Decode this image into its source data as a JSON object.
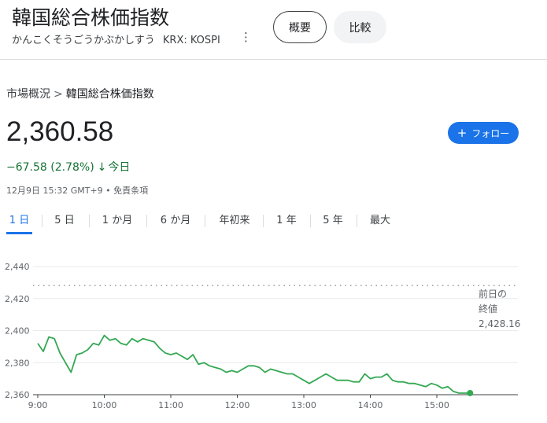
{
  "header": {
    "title": "韓国総合株価指数",
    "reading": "かんこくそうごうかぶかしすう",
    "ticker": "KRX: KOSPI",
    "more_icon": "⋮",
    "overview_label": "概要",
    "compare_label": "比較"
  },
  "breadcrumb": {
    "parent": "市場概況",
    "separator": ">",
    "current": "韓国総合株価指数"
  },
  "quote": {
    "price": "2,360.58",
    "change": "−67.58 (2.78%)",
    "arrow": "🡓",
    "period": "今日",
    "meta": "12月9日 15:32 GMT+9 • 免責条項"
  },
  "follow": {
    "icon": "+",
    "label": "フォロー"
  },
  "tabs": [
    "1 日",
    "5 日",
    "1 か月",
    "6 か月",
    "年初来",
    "1 年",
    "5 年",
    "最大"
  ],
  "previous_close": {
    "label_line1": "前日の",
    "label_line2": "終値",
    "value": "2,428.16"
  },
  "colors": {
    "accent": "#1a73e8",
    "down": "#137333",
    "line": "#34a853"
  },
  "chart_data": {
    "type": "line",
    "yticks": [
      "2,440",
      "2,420",
      "2,400",
      "2,380",
      "2,360"
    ],
    "xticks": [
      "9:00",
      "10:00",
      "11:00",
      "12:00",
      "13:00",
      "14:00",
      "15:00"
    ],
    "ylim": [
      2360,
      2445
    ],
    "reference_line": 2428.16,
    "series": [
      {
        "x": [
          "9:00",
          "9:05",
          "9:10",
          "9:15",
          "9:20",
          "9:25",
          "9:30",
          "9:35",
          "9:40",
          "9:45",
          "9:50",
          "9:55",
          "10:00",
          "10:05",
          "10:10",
          "10:15",
          "10:20",
          "10:25",
          "10:30",
          "10:35",
          "10:40",
          "10:45",
          "10:50",
          "10:55",
          "11:00",
          "11:05",
          "11:10",
          "11:15",
          "11:20",
          "11:25",
          "11:30",
          "11:35",
          "11:40",
          "11:45",
          "11:50",
          "11:55",
          "12:00",
          "12:05",
          "12:10",
          "12:15",
          "12:20",
          "12:25",
          "12:30",
          "12:35",
          "12:40",
          "12:45",
          "12:50",
          "12:55",
          "13:00",
          "13:05",
          "13:10",
          "13:15",
          "13:20",
          "13:25",
          "13:30",
          "13:35",
          "13:40",
          "13:45",
          "13:50",
          "13:55",
          "14:00",
          "14:05",
          "14:10",
          "14:15",
          "14:20",
          "14:25",
          "14:30",
          "14:35",
          "14:40",
          "14:45",
          "14:50",
          "14:55",
          "15:00",
          "15:05",
          "15:10",
          "15:15",
          "15:20",
          "15:25",
          "15:30"
        ],
        "values": [
          2392,
          2387,
          2396,
          2395,
          2386,
          2380,
          2374,
          2385,
          2386,
          2388,
          2392,
          2391,
          2397,
          2394,
          2395,
          2392,
          2391,
          2395,
          2393,
          2395,
          2394,
          2393,
          2389,
          2386,
          2385,
          2386,
          2384,
          2382,
          2385,
          2379,
          2380,
          2378,
          2377,
          2376,
          2374,
          2375,
          2374,
          2376,
          2378,
          2378,
          2377,
          2374,
          2376,
          2375,
          2374,
          2373,
          2373,
          2371,
          2369,
          2367,
          2369,
          2371,
          2373,
          2371,
          2369,
          2369,
          2369,
          2368,
          2368,
          2373,
          2370,
          2371,
          2371,
          2373,
          2369,
          2368,
          2368,
          2367,
          2367,
          2366,
          2365,
          2367,
          2366,
          2364,
          2365,
          2362,
          2361,
          2361,
          2361
        ]
      }
    ]
  }
}
